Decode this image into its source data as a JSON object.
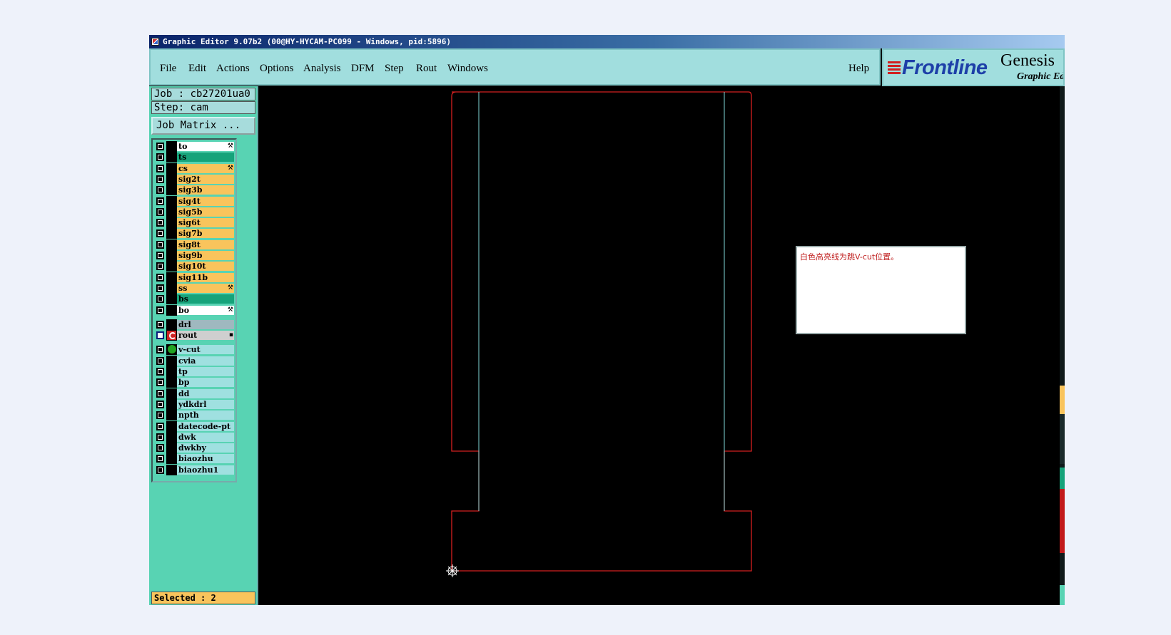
{
  "window": {
    "title": "Graphic Editor 9.07b2 (00@HY-HYCAM-PC099 - Windows, pid:5896)"
  },
  "menu": {
    "items": [
      "File",
      "Edit",
      "Actions",
      "Options",
      "Analysis",
      "DFM",
      "Step",
      "Rout",
      "Windows"
    ],
    "help": "Help"
  },
  "logo": {
    "brand": "Frontline",
    "product": "Genesis",
    "subtitle": "Graphic Ed"
  },
  "job": {
    "job": "Job : cb27201ua0",
    "step": "Step: cam",
    "matrix_button": "Job Matrix ..."
  },
  "layers": [
    {
      "name": "to",
      "color": "white",
      "mark": "wrench"
    },
    {
      "name": "ts",
      "color": "green"
    },
    {
      "name": "cs",
      "color": "orange",
      "mark": "wrench"
    },
    {
      "name": "sig2t",
      "color": "orange"
    },
    {
      "name": "sig3b",
      "color": "orange"
    },
    {
      "name": "sig4t",
      "color": "orange"
    },
    {
      "name": "sig5b",
      "color": "orange"
    },
    {
      "name": "sig6t",
      "color": "orange"
    },
    {
      "name": "sig7b",
      "color": "orange"
    },
    {
      "name": "sig8t",
      "color": "orange"
    },
    {
      "name": "sig9b",
      "color": "orange"
    },
    {
      "name": "sig10t",
      "color": "orange"
    },
    {
      "name": "sig11b",
      "color": "orange"
    },
    {
      "name": "ss",
      "color": "orange",
      "mark": "wrench"
    },
    {
      "name": "bs",
      "color": "green"
    },
    {
      "name": "bo",
      "color": "white",
      "mark": "wrench"
    },
    {
      "name": "drl",
      "color": "gray",
      "gap": true
    },
    {
      "name": "rout",
      "color": "lgray",
      "checked": true,
      "status": "rout-icon",
      "mark": "square"
    },
    {
      "name": "v-cut",
      "color": "cyan",
      "gap": true,
      "status": "green-dot"
    },
    {
      "name": "cvia",
      "color": "cyan"
    },
    {
      "name": "tp",
      "color": "cyan"
    },
    {
      "name": "bp",
      "color": "cyan"
    },
    {
      "name": "dd",
      "color": "cyan"
    },
    {
      "name": "ydkdrl",
      "color": "cyan"
    },
    {
      "name": "npth",
      "color": "cyan"
    },
    {
      "name": "datecode-pt",
      "color": "cyan"
    },
    {
      "name": "dwk",
      "color": "cyan"
    },
    {
      "name": "dwkby",
      "color": "cyan"
    },
    {
      "name": "biaozhu",
      "color": "cyan"
    },
    {
      "name": "biaozhu1",
      "color": "cyan"
    }
  ],
  "status": {
    "selected": "Selected : 2"
  },
  "note": {
    "text": "白色高亮线为跳V-cut位置。"
  },
  "colors": {
    "outline": "#d42020",
    "vcut": "#7fd6d6",
    "menubar": "#a1dede",
    "panel": "#58d3b3"
  }
}
